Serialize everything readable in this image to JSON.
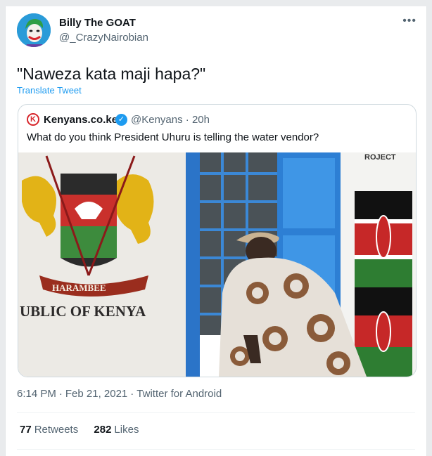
{
  "tweet": {
    "author_name": "Billy The GOAT",
    "author_handle": "@_CrazyNairobian",
    "avatar_icon": "joker-avatar",
    "more_icon": "more-icon",
    "text": "\"Naweza kata maji hapa?\"",
    "translate_label": "Translate Tweet",
    "time": "6:14 PM",
    "date": "Feb 21, 2021",
    "source": "Twitter for Android",
    "retweets_count": "77",
    "retweets_label": "Retweets",
    "likes_count": "282",
    "likes_label": "Likes"
  },
  "quote": {
    "logo_letter": "K",
    "logo_icon": "kenyans-logo-icon",
    "name": "Kenyans.co.ke",
    "verified_icon": "verified-badge-icon",
    "handle": "@Kenyans",
    "dot": "·",
    "age": "20h",
    "text": "What do you think President Uhuru is telling the water vendor?",
    "photo": {
      "mural_top_text": "HARAMBEE",
      "mural_bottom_text": "UBLIC OF KENYA",
      "sign_fragment": "ROJECT"
    }
  },
  "colors": {
    "accent": "#1d9bf0",
    "text_primary": "#0f1419",
    "text_secondary": "#536471",
    "kenyans_red": "#d7262b"
  }
}
